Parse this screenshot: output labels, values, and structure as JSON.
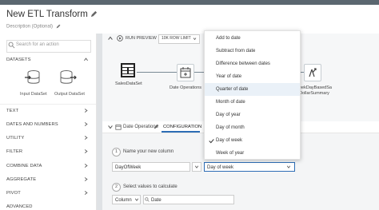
{
  "header": {
    "title": "New ETL Transform",
    "description_placeholder": "Description (Optional)"
  },
  "sidebar": {
    "search_placeholder": "Search for an action",
    "datasets_label": "DATASETS",
    "tiles": [
      {
        "label": "Input DataSet",
        "icon": "database-import-icon"
      },
      {
        "label": "Output DataSet",
        "icon": "database-export-icon"
      }
    ],
    "sections": [
      "TEXT",
      "DATES AND NUMBERS",
      "UTILITY",
      "FILTER",
      "COMBINE DATA",
      "AGGREGATE",
      "PIVOT",
      "ADVANCED"
    ]
  },
  "toolbar": {
    "run_preview": "RUN PREVIEW",
    "row_limit": "10K ROW LIMIT"
  },
  "canvas": {
    "nodes": [
      {
        "label": "SalesDataSet",
        "icon": "dataset-icon"
      },
      {
        "label": "Date Operations",
        "icon": "calendar-plus-icon"
      },
      {
        "label_line1": "eekDayBasedSa",
        "label_line2": "DollarSummary",
        "icon": "output-icon"
      }
    ]
  },
  "bottom_tabs": {
    "node_name": "Date Operations",
    "configuration": "CONFIGURATION"
  },
  "form": {
    "step1_number": "1",
    "step1_label": "Name your new column",
    "column_name_value": "DayOfWeek",
    "operation_value": "Day of week",
    "step2_number": "2",
    "step2_label": "Select values to calculate",
    "source_type_value": "Column",
    "source_column_value": "Date"
  },
  "dropdown_menu": {
    "items": [
      {
        "label": "Add to date",
        "selected": false,
        "hovered": false
      },
      {
        "label": "Subtract from date",
        "selected": false,
        "hovered": false
      },
      {
        "label": "Difference between dates",
        "selected": false,
        "hovered": false
      },
      {
        "label": "Year of date",
        "selected": false,
        "hovered": false
      },
      {
        "label": "Quarter of date",
        "selected": false,
        "hovered": true
      },
      {
        "label": "Month of date",
        "selected": false,
        "hovered": false
      },
      {
        "label": "Day of year",
        "selected": false,
        "hovered": false
      },
      {
        "label": "Day of month",
        "selected": false,
        "hovered": false
      },
      {
        "label": "Day of week",
        "selected": true,
        "hovered": false
      },
      {
        "label": "Week of year",
        "selected": false,
        "hovered": false
      }
    ]
  },
  "colors": {
    "topbar": "#5b6770",
    "accent_blue": "#2d6db5",
    "highlight": "#eaf1f8"
  }
}
